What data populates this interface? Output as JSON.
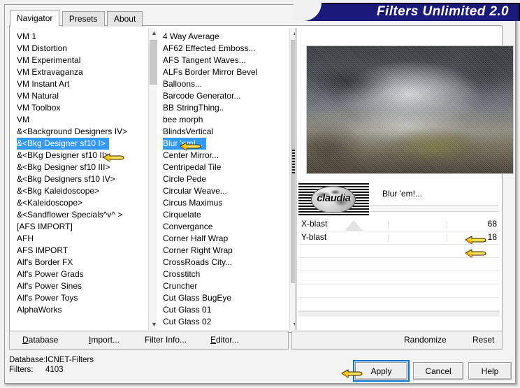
{
  "window": {
    "title": "Filters Unlimited 2.0"
  },
  "tabs": [
    {
      "label": "Navigator",
      "active": true
    },
    {
      "label": "Presets",
      "active": false
    },
    {
      "label": "About",
      "active": false
    }
  ],
  "navigator_list": {
    "selected": "&<Bkg Designer sf10 I>",
    "items": [
      "VM 1",
      "VM Distortion",
      "VM Experimental",
      "VM Extravaganza",
      "VM Instant Art",
      "VM Natural",
      "VM Toolbox",
      "VM",
      "&<Background Designers IV>",
      "&<Bkg Designer sf10 I>",
      "&<BKg Designer sf10 II>",
      "&<Bkg Designer sf10 III>",
      "&<Bkg Designers sf10 IV>",
      "&<Bkg Kaleidoscope>",
      "&<Kaleidoscope>",
      "&<Sandflower Specials^v^ >",
      "[AFS IMPORT]",
      "AFH",
      "AFS IMPORT",
      "Alf's Border FX",
      "Alf's Power Grads",
      "Alf's Power Sines",
      "Alf's Power Toys",
      "AlphaWorks"
    ]
  },
  "filter_list": {
    "selected": "Blur 'em!...",
    "items": [
      "4 Way Average",
      "AF62 Effected Emboss...",
      "AFS Tangent Waves...",
      "ALFs Border Mirror Bevel",
      "Balloons...",
      "Barcode Generator...",
      "BB StringThing..",
      "bee morph",
      "BlindsVertical",
      "Blur 'em!...",
      "Center Mirror...",
      "Centripedal Tile",
      "Circle Pede",
      "Circular Weave...",
      "Circus Maximus",
      "Cirquelate",
      "Convergance",
      "Corner Half Wrap",
      "Corner Right Wrap",
      "CrossRoads City...",
      "Crosstitch",
      "Cruncher",
      "Cut Glass  BugEye",
      "Cut Glass 01",
      "Cut Glass 02"
    ]
  },
  "preview": {
    "thumbnail_label": "claudia",
    "filter_name": "Blur 'em!..."
  },
  "parameters": [
    {
      "label": "X-blast",
      "value": "68"
    },
    {
      "label": "Y-blast",
      "value": "18"
    }
  ],
  "action_bar": {
    "left": [
      {
        "accel": "D",
        "rest": "atabase"
      },
      {
        "accel": "I",
        "rest": "mport..."
      },
      {
        "accel": "",
        "rest": "Filter Info..."
      },
      {
        "accel": "E",
        "rest": "ditor..."
      }
    ],
    "right": [
      {
        "label": "Randomize"
      },
      {
        "label": "Reset"
      }
    ]
  },
  "status": {
    "database_label": "Database:",
    "database_value": "ICNET-Filters",
    "filters_label": "Filters:",
    "filters_value": "4103"
  },
  "dialog_buttons": {
    "apply": "Apply",
    "cancel": "Cancel",
    "help": "Help"
  },
  "colors": {
    "banner": "#1a1a7a",
    "selection": "#3399ff",
    "focus": "#0b6fd4",
    "cursor": "#f5c518"
  }
}
